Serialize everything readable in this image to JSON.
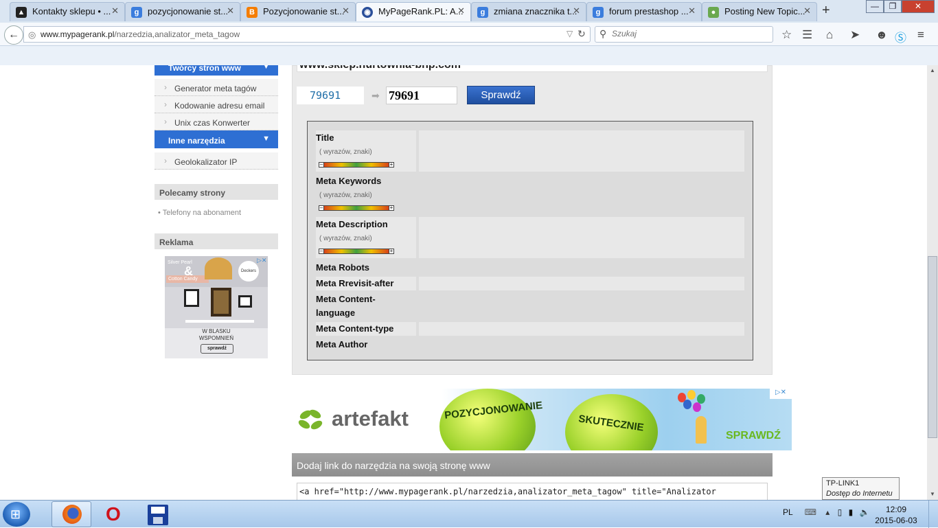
{
  "browser": {
    "tabs": [
      {
        "label": "Kontakty sklepu • ...",
        "icon": "sklep-favicon"
      },
      {
        "label": "pozycjonowanie st...",
        "icon": "google-icon"
      },
      {
        "label": "Pozycjonowanie st...",
        "icon": "blogger-icon"
      },
      {
        "label": "MyPageRank.PL: A...",
        "icon": "globe-icon",
        "active": true
      },
      {
        "label": "zmiana znacznika t...",
        "icon": "google-icon"
      },
      {
        "label": "forum prestashop ...",
        "icon": "google-icon"
      },
      {
        "label": "Posting New Topic...",
        "icon": "forum-icon"
      }
    ],
    "new_tab": "+",
    "url_domain": "www.mypagerank.pl",
    "url_path": "/narzedzia,analizator_meta_tagow",
    "search_placeholder": "Szukaj"
  },
  "sidebar": {
    "menu_top": "Twórcy stron www",
    "items1": [
      "Generator meta tagów",
      "Kodowanie adresu email",
      "Unix czas Konwerter"
    ],
    "menu_other": "Inne narzędzia",
    "items2": [
      "Geolokalizator IP"
    ],
    "recommended_title": "Polecamy strony",
    "recommended_link": "Telefony na abonament",
    "ads_title": "Reklama",
    "ad": {
      "brand1": "Silver Pearl",
      "brand2": "Cotton Candy",
      "line1": "W BLASKU",
      "line2": "WSPOMNIEŃ",
      "button": "sprawdź",
      "logo": "Deckers"
    }
  },
  "main": {
    "domain": "www.sklep.hurtownia-bhp.com",
    "captcha": "79691",
    "captcha_input": "79691",
    "check_button": "Sprawdź",
    "results": [
      {
        "label": "Title",
        "sub": "( wyrazów, znaki)"
      },
      {
        "label": "Meta Keywords",
        "sub": "( wyrazów, znaki)"
      },
      {
        "label": "Meta Description",
        "sub": "( wyrazów, znaki)"
      },
      {
        "label": "Meta Robots"
      },
      {
        "label": "Meta Rrevisit-after"
      },
      {
        "label": "Meta Content-language"
      },
      {
        "label": "Meta Content-type"
      },
      {
        "label": "Meta Author"
      }
    ],
    "gauge_minus": "–",
    "gauge_plus": "+"
  },
  "banner": {
    "brand": "artefakt",
    "balloon1": "POZYCJONOWANIE",
    "balloon2": "SKUTECZNIE",
    "cta": "SPRAWDŹ"
  },
  "link_section": {
    "title": "Dodaj link do narzędzia na swoją stronę www",
    "code": "<a href=\"http://www.mypagerank.pl/narzedzia,analizator_meta_tagow\" title=\"Analizator"
  },
  "tooltip": {
    "line1": "TP-LINK1",
    "line2": "Dostęp do Internetu"
  },
  "taskbar": {
    "lang": "PL",
    "time": "12:09",
    "date": "2015-06-03"
  }
}
